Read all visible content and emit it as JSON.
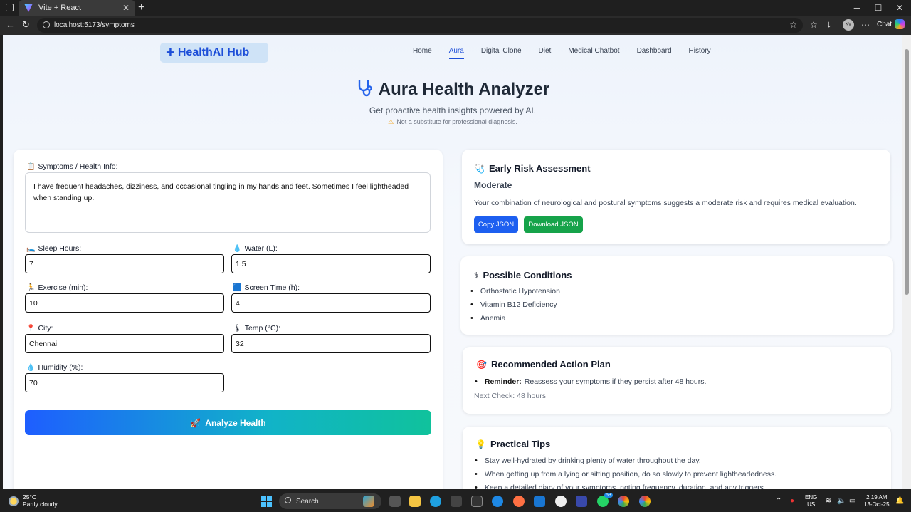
{
  "browser": {
    "tab_title": "Vite + React",
    "url": "localhost:5173/symptoms",
    "chat_label": "Chat",
    "profile_initials": "KV"
  },
  "nav": {
    "brand": "HealthAI Hub",
    "links": [
      "Home",
      "Aura",
      "Digital Clone",
      "Diet",
      "Medical Chatbot",
      "Dashboard",
      "History"
    ],
    "active": "Aura"
  },
  "hero": {
    "title": "Aura Health Analyzer",
    "subtitle": "Get proactive health insights powered by AI.",
    "warning": "Not a substitute for professional diagnosis."
  },
  "form": {
    "symptoms_label": "Symptoms / Health Info:",
    "symptoms_value": "I have frequent headaches, dizziness, and occasional tingling in my hands and feet. Sometimes I feel lightheaded when standing up.",
    "sleep_label": "Sleep Hours:",
    "sleep_value": "7",
    "water_label": "Water (L):",
    "water_value": "1.5",
    "exercise_label": "Exercise (min):",
    "exercise_value": "10",
    "screen_label": "Screen Time (h):",
    "screen_value": "4",
    "city_label": "City:",
    "city_value": "Chennai",
    "temp_label": "Temp (°C):",
    "temp_value": "32",
    "humidity_label": "Humidity (%):",
    "humidity_value": "70",
    "analyze_label": "Analyze Health"
  },
  "risk": {
    "title": "Early Risk Assessment",
    "level": "Moderate",
    "description": "Your combination of neurological and postural symptoms suggests a moderate risk and requires medical evaluation.",
    "copy_label": "Copy JSON",
    "download_label": "Download JSON",
    "copy_color": "#1d5ff0",
    "download_color": "#16a34a"
  },
  "conditions": {
    "title": "Possible Conditions",
    "items": [
      "Orthostatic Hypotension",
      "Vitamin B12 Deficiency",
      "Anemia"
    ]
  },
  "action_plan": {
    "title": "Recommended Action Plan",
    "reminder_label": "Reminder:",
    "reminder_text": "Reassess your symptoms if they persist after 48 hours.",
    "next_check": "Next Check: 48 hours"
  },
  "tips": {
    "title": "Practical Tips",
    "items": [
      "Stay well-hydrated by drinking plenty of water throughout the day.",
      "When getting up from a lying or sitting position, do so slowly to prevent lightheadedness.",
      "Keep a detailed diary of your symptoms, noting frequency, duration, and any triggers."
    ]
  },
  "taskbar": {
    "temperature": "25°C",
    "weather": "Partly cloudy",
    "search": "Search",
    "lang": "ENG",
    "region": "US",
    "time": "2:19 AM",
    "date": "13-Oct-25",
    "badge": "53"
  }
}
